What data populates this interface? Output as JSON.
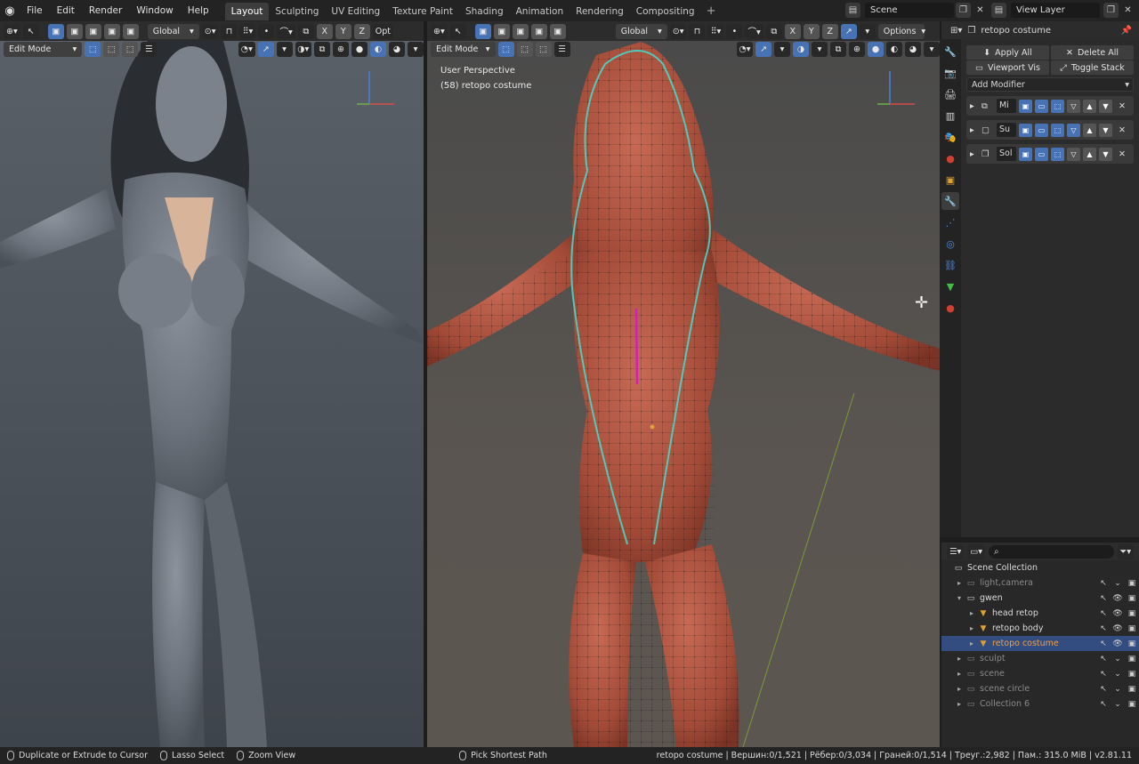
{
  "menu": {
    "items": [
      "File",
      "Edit",
      "Render",
      "Window",
      "Help"
    ]
  },
  "workspaces": {
    "tabs": [
      "Layout",
      "Sculpting",
      "UV Editing",
      "Texture Paint",
      "Shading",
      "Animation",
      "Rendering",
      "Compositing"
    ],
    "active": "Layout"
  },
  "scene": {
    "name": "Scene"
  },
  "view_layer": {
    "name": "View Layer"
  },
  "viewport_left": {
    "mode": "Edit Mode",
    "orientation": "Global",
    "axes": [
      "X",
      "Y",
      "Z"
    ],
    "options_truncated": "Opt"
  },
  "viewport_right": {
    "mode": "Edit Mode",
    "orientation": "Global",
    "axes": [
      "X",
      "Y",
      "Z"
    ],
    "options": "Options",
    "perspective_label": "User Perspective",
    "object_label": "(58) retopo costume"
  },
  "properties": {
    "object_name": "retopo costume",
    "apply_all": "Apply All",
    "delete_all": "Delete All",
    "viewport_vis": "Viewport Vis",
    "toggle_stack": "Toggle Stack",
    "add_modifier": "Add Modifier",
    "modifiers": [
      {
        "name": "Mi",
        "icon": "mirror-icon"
      },
      {
        "name": "Su",
        "icon": "subsurf-icon"
      },
      {
        "name": "Sol",
        "icon": "solidify-icon"
      }
    ]
  },
  "outliner": {
    "root": "Scene Collection",
    "rows": [
      {
        "label": "light,camera",
        "dim": true,
        "indent": 1,
        "expanded": false,
        "badges": "2  8"
      },
      {
        "label": "gwen",
        "dim": false,
        "indent": 1,
        "expanded": true,
        "badges": ""
      },
      {
        "label": "head retop",
        "dim": false,
        "indent": 2,
        "expanded": false,
        "badges": ""
      },
      {
        "label": "retopo body",
        "dim": false,
        "indent": 2,
        "expanded": false,
        "badges": ""
      },
      {
        "label": "retopo costume",
        "dim": false,
        "indent": 2,
        "expanded": false,
        "selected": true,
        "badges": ""
      },
      {
        "label": "sculpt",
        "dim": true,
        "indent": 1,
        "expanded": false,
        "badges": "2"
      },
      {
        "label": "scene",
        "dim": true,
        "indent": 1,
        "expanded": false,
        "badges": "2"
      },
      {
        "label": "scene circle",
        "dim": true,
        "indent": 1,
        "expanded": false,
        "badges": ""
      },
      {
        "label": "Collection 6",
        "dim": true,
        "indent": 1,
        "expanded": false,
        "badges": "2"
      }
    ]
  },
  "statusbar": {
    "left1": "Duplicate or Extrude to Cursor",
    "left2": "Lasso Select",
    "left3": "Zoom View",
    "middle": "Pick Shortest Path",
    "stats": "retopo costume | Вершин:0/1,521 | Рёбер:0/3,034 | Граней:0/1,514 | Треуг.:2,982 | Пам.: 315.0 MiB | v2.81.11"
  },
  "colors": {
    "accent": "#4772b3",
    "selection": "#334d80",
    "mesh": "#b5523f"
  }
}
